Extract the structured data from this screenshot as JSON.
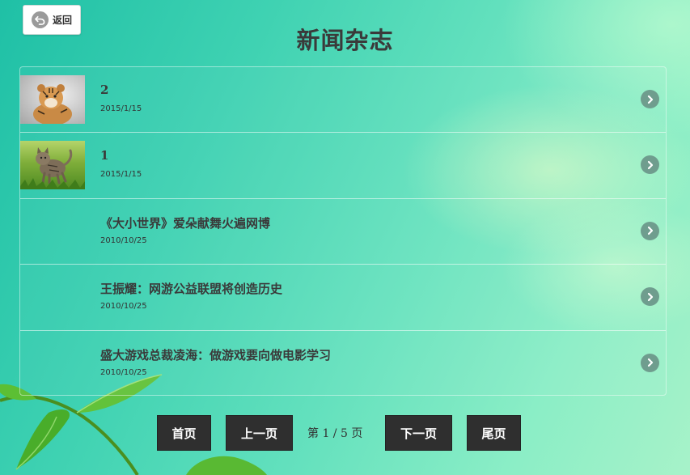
{
  "header": {
    "back_label": "返回",
    "title": "新闻杂志"
  },
  "list": {
    "items": [
      {
        "title": "2",
        "date": "2015/1/15",
        "thumb": "tiger-cub"
      },
      {
        "title": "1",
        "date": "2015/1/15",
        "thumb": "kitten-grass"
      },
      {
        "title": "《大小世界》爱朵献舞火遍网博",
        "date": "2010/10/25",
        "thumb": ""
      },
      {
        "title": "王振耀：网游公益联盟将创造历史",
        "date": "2010/10/25",
        "thumb": ""
      },
      {
        "title": "盛大游戏总裁凌海：做游戏要向做电影学习",
        "date": "2010/10/25",
        "thumb": ""
      }
    ]
  },
  "pager": {
    "first": "首页",
    "prev": "上一页",
    "info": "第 1 / 5 页",
    "next": "下一页",
    "last": "尾页"
  },
  "colors": {
    "accent": "#2f2f2f",
    "chevron": "#6f9d8e"
  }
}
